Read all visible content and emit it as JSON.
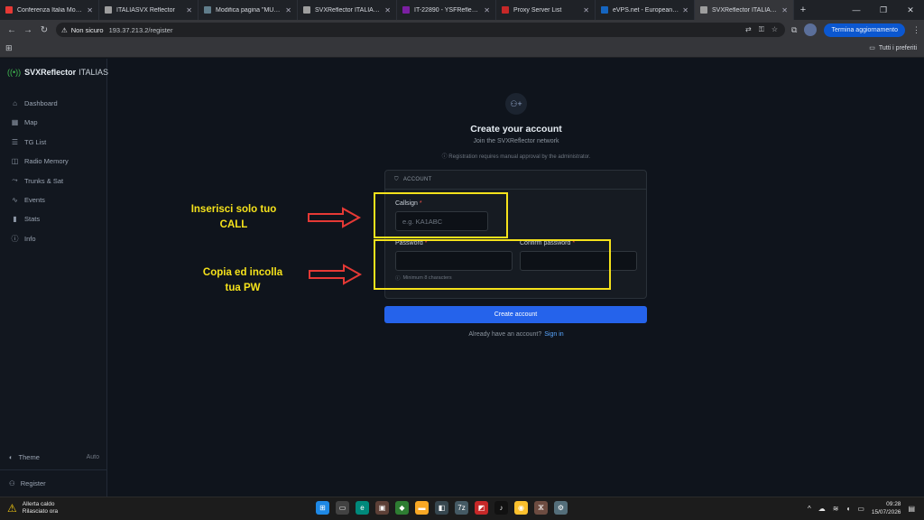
{
  "browser": {
    "tabs": [
      {
        "title": "Conferenza Italia Monitor",
        "color": "#e53935"
      },
      {
        "title": "ITALIASVX Reflector",
        "color": "#9e9e9e"
      },
      {
        "title": "Modifica pagina \"MUMBI",
        "color": "#607d8b"
      },
      {
        "title": "SVXReflector ITALIASVX",
        "color": "#9e9e9e"
      },
      {
        "title": "IT-22890 - YSFReflector-D",
        "color": "#7b1fa2"
      },
      {
        "title": "Proxy Server List",
        "color": "#c62828"
      },
      {
        "title": "eVPS.net - European VPS",
        "color": "#1565c0"
      },
      {
        "title": "SVXReflector ITALIASVX",
        "color": "#9e9e9e"
      }
    ],
    "security_label": "Non sicuro",
    "url": "193.37.213.2/register",
    "update_button": "Termina aggiornamento",
    "bookmarks_label": "Tutti i preferiti"
  },
  "sidebar": {
    "brand_primary": "SVXReflector",
    "brand_secondary": "ITALIASVX",
    "items": [
      {
        "label": "Dashboard",
        "icon": "⌂"
      },
      {
        "label": "Map",
        "icon": "▦"
      },
      {
        "label": "TG List",
        "icon": "☰"
      },
      {
        "label": "Radio Memory",
        "icon": "◫"
      },
      {
        "label": "Trunks & Sat",
        "icon": "⤳"
      },
      {
        "label": "Events",
        "icon": "∿"
      },
      {
        "label": "Stats",
        "icon": "▮"
      },
      {
        "label": "Info",
        "icon": "ⓘ"
      }
    ],
    "theme_label": "Theme",
    "theme_value": "Auto",
    "register_label": "Register"
  },
  "register": {
    "title": "Create your account",
    "subtitle": "Join the SVXReflector network",
    "note": "Registration requires manual approval by the administrator.",
    "section_label": "ACCOUNT",
    "callsign_label": "Callsign",
    "callsign_placeholder": "e.g. KA1ABC",
    "password_label": "Password",
    "confirm_label": "Confirm password",
    "password_hint": "Minimum 8 characters",
    "required_mark": "*",
    "submit_label": "Create account",
    "signin_prompt": "Already have an account?",
    "signin_link": "Sign in"
  },
  "annotations": {
    "call_line1": "Inserisci solo tuo",
    "call_line2": "CALL",
    "pw_line1": "Copia ed incolla",
    "pw_line2": "tua PW",
    "highlight_color": "#f5e21b",
    "arrow_color": "#e53935"
  },
  "taskbar": {
    "weather_title": "Allerta caldo",
    "weather_sub": "Rilasciato ora",
    "time": "09:28",
    "date": "15/07/2026"
  }
}
